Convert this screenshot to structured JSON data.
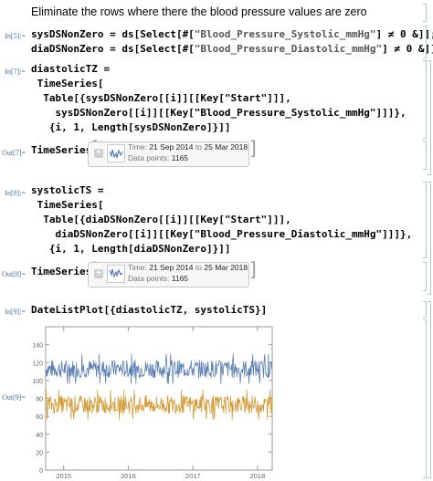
{
  "header_text": "Eliminate the rows where there the blood pressure values are zero",
  "cells": {
    "in5": {
      "label": "In[5]:=",
      "lines": [
        [
          "sysDSNonZero = ds[Select[#[",
          "\"Blood_Pressure_Systolic_mmHg\"",
          "] ≠ 0 &]];"
        ],
        [
          "diaDSNonZero = ds[Select[#[",
          "\"Blood_Pressure_Diastolic_mmHg\"",
          "] ≠ 0 &]];"
        ]
      ]
    },
    "in7": {
      "label": "In[7]:=",
      "lines": [
        "diastolicTZ =",
        " TimeSeries[",
        "  Table[{sysDSNonZero[[i]][[Key[\"Start\"]]],",
        "    sysDSNonZero[[i]][[Key[\"Blood_Pressure_Systolic_mmHg\"]]]},",
        "   {i, 1, Length[sysDSNonZero]}]]"
      ]
    },
    "out7": {
      "label": "Out[7]=",
      "head": "TimeSeries",
      "time_label": "Time:",
      "time_from": "21 Sep 2014",
      "time_to_word": "to",
      "time_to": "25 Mar 2018",
      "points_label": "Data points:",
      "points": "1165"
    },
    "in8": {
      "label": "In[8]:=",
      "lines": [
        "systolicTS =",
        " TimeSeries[",
        "  Table[{diaDSNonZero[[i]][[Key[\"Start\"]]],",
        "    diaDSNonZero[[i]][[Key[\"Blood_Pressure_Diastolic_mmHg\"]]]},",
        "   {i, 1, Length[diaDSNonZero]}]]"
      ]
    },
    "out8": {
      "label": "Out[8]=",
      "head": "TimeSeries",
      "time_label": "Time:",
      "time_from": "21 Sep 2014",
      "time_to_word": "to",
      "time_to": "25 Mar 2018",
      "points_label": "Data points:",
      "points": "1165"
    },
    "in9": {
      "label": "In[9]:=",
      "code": "DateListPlot[{diastolicTZ, systolicTS}]"
    },
    "out9": {
      "label": "Out[9]="
    }
  },
  "chart_data": {
    "type": "line",
    "title": "",
    "xlabel": "",
    "ylabel": "",
    "x_range": [
      "2014-09-21",
      "2018-03-25"
    ],
    "ylim": [
      0,
      160
    ],
    "y_ticks": [
      0,
      20,
      40,
      60,
      80,
      100,
      120,
      140
    ],
    "x_ticks": [
      "2015",
      "2016",
      "2017",
      "2018"
    ],
    "grid": false,
    "series": [
      {
        "color": "#5b7fb4",
        "approx_mean": 113,
        "approx_range": [
          100,
          125
        ]
      },
      {
        "color": "#d49a36",
        "approx_mean": 73,
        "approx_range": [
          60,
          85
        ]
      }
    ],
    "points_per_series": 1165
  }
}
